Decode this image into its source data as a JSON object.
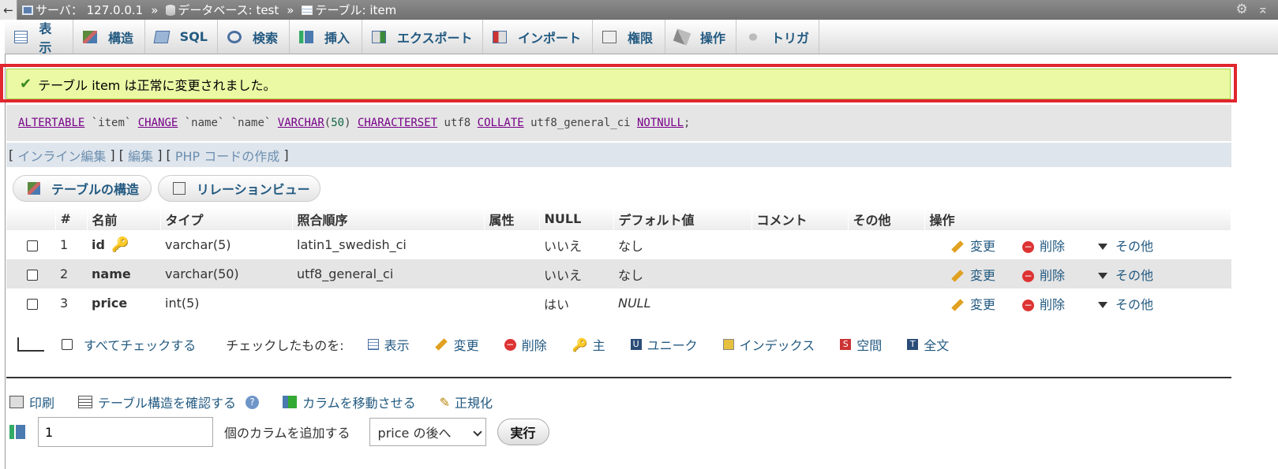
{
  "breadcrumb": {
    "server": "サーバ： 127.0.0.1",
    "database": "データベース: test",
    "table": "テーブル: item",
    "separator": "»"
  },
  "tabs": [
    "表示",
    "構造",
    "SQL",
    "検索",
    "挿入",
    "エクスポート",
    "インポート",
    "権限",
    "操作",
    "トリガ"
  ],
  "message": "テーブル item は正常に変更されました。",
  "sql_query": "ALTER TABLE `item` CHANGE `name` `name` VARCHAR(50) CHARACTER SET utf8 COLLATE utf8_general_ci NOT NULL;",
  "sql_actions": {
    "inline_edit": "インライン編集",
    "edit": "編集",
    "php_code": "PHP コードの作成"
  },
  "sub_buttons": {
    "structure": "テーブルの構造",
    "relation": "リレーションビュー"
  },
  "table": {
    "headers": [
      "#",
      "名前",
      "タイプ",
      "照合順序",
      "属性",
      "NULL",
      "デフォルト値",
      "コメント",
      "その他",
      "操作"
    ],
    "rows": [
      {
        "num": "1",
        "name": "id",
        "type": "varchar(5)",
        "collation": "latin1_swedish_ci",
        "attr": "",
        "null": "いいえ",
        "default": "なし",
        "comment": "",
        "extra": "",
        "primary": true
      },
      {
        "num": "2",
        "name": "name",
        "type": "varchar(50)",
        "collation": "utf8_general_ci",
        "attr": "",
        "null": "いいえ",
        "default": "なし",
        "comment": "",
        "extra": "",
        "primary": false
      },
      {
        "num": "3",
        "name": "price",
        "type": "int(5)",
        "collation": "",
        "attr": "",
        "null": "はい",
        "default": "NULL",
        "comment": "",
        "extra": "",
        "primary": false
      }
    ],
    "actions": {
      "change": "変更",
      "drop": "削除",
      "more": "その他"
    }
  },
  "bulk": {
    "check_all": "すべてチェックする",
    "with_selected": "チェックしたものを:",
    "browse": "表示",
    "change": "変更",
    "drop": "削除",
    "primary": "主",
    "unique": "ユニーク",
    "index": "インデックス",
    "spatial": "空間",
    "fulltext": "全文"
  },
  "bottom": {
    "print": "印刷",
    "propose_structure": "テーブル構造を確認する",
    "move_columns": "カラムを移動させる",
    "normalize": "正規化",
    "add_count": "1",
    "add_label": "個のカラムを追加する",
    "after_option": "price の後へ",
    "go": "実行"
  }
}
